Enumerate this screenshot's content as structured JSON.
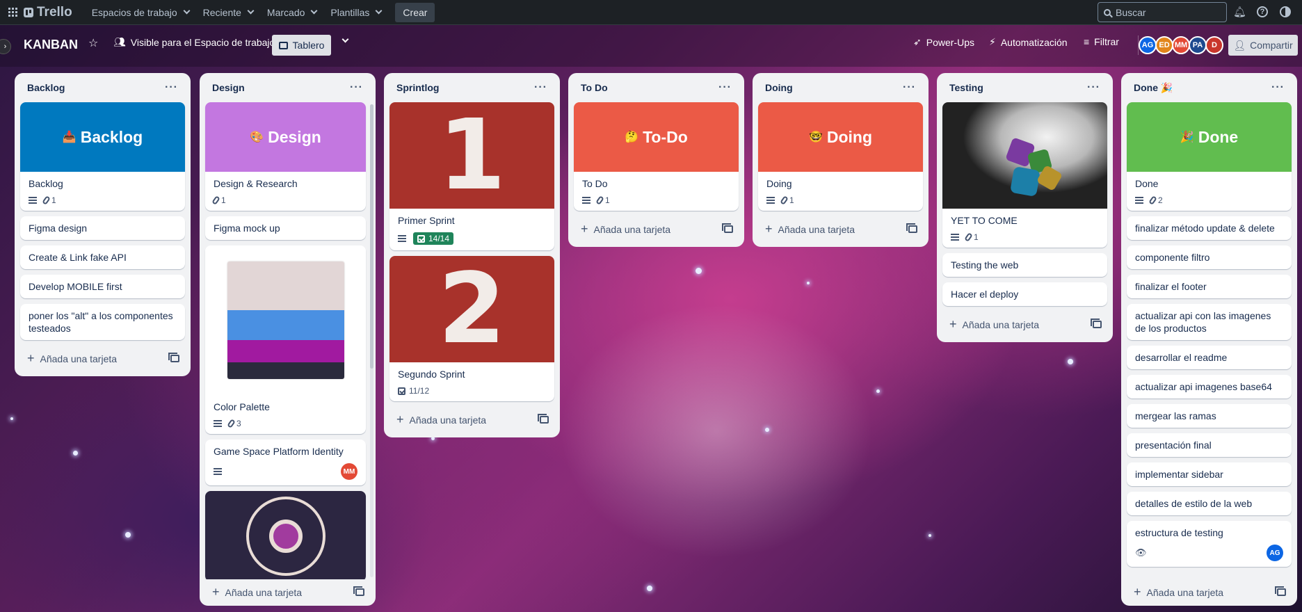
{
  "topnav": {
    "brand": "Trello",
    "menus": [
      "Espacios de trabajo",
      "Reciente",
      "Marcado",
      "Plantillas"
    ],
    "create": "Crear",
    "search_placeholder": "Buscar"
  },
  "board": {
    "title": "KANBAN",
    "visibility": "Visible para el Espacio de trabajo",
    "view": "Tablero",
    "powerups": "Power-Ups",
    "automation": "Automatización",
    "filter": "Filtrar",
    "share": "Compartir",
    "members": [
      {
        "initials": "AG",
        "color": "#0c66e4"
      },
      {
        "initials": "ED",
        "color": "#e2851a"
      },
      {
        "initials": "MM",
        "color": "#e34935"
      },
      {
        "initials": "PA",
        "color": "#1d4a8f"
      },
      {
        "initials": "D",
        "color": "#c9372c"
      }
    ]
  },
  "lists": {
    "backlog": {
      "title": "Backlog",
      "cover": {
        "label": "Backlog",
        "emoji": "📥",
        "color": "#0079bf"
      },
      "first_card": "Backlog",
      "first_attach": "1",
      "cards": [
        "Figma design",
        "Create & Link fake API",
        "Develop MOBILE first",
        "poner los \"alt\" a los componentes testeados"
      ],
      "add": "Añada una tarjeta"
    },
    "design": {
      "title": "Design",
      "cover": {
        "label": "Design",
        "emoji": "🎨",
        "color": "#c377e0"
      },
      "first_card": "Design & Research",
      "first_attach": "1",
      "card2": "Figma mock up",
      "palette_title": "Color Palette",
      "palette_attach": "3",
      "palette_colors": [
        "#e2d6d6",
        "#4a90e2",
        "#a11aa0",
        "#2a2a3c"
      ],
      "identity_title": "Game Space Platform Identity",
      "identity_member": "MM",
      "add": "Añada una tarjeta"
    },
    "sprintlog": {
      "title": "Sprintlog",
      "sprint1_num": "1",
      "sprint1_title": "Primer Sprint",
      "sprint1_check": "14/14",
      "sprint2_num": "2",
      "sprint2_title": "Segundo Sprint",
      "sprint2_check": "11/12",
      "add": "Añada una tarjeta"
    },
    "todo": {
      "title": "To Do",
      "cover": {
        "label": "To-Do",
        "emoji": "🤔",
        "color": "#eb5a46"
      },
      "first_card": "To Do",
      "first_attach": "1",
      "add": "Añada una tarjeta"
    },
    "doing": {
      "title": "Doing",
      "cover": {
        "label": "Doing",
        "emoji": "🤓",
        "color": "#eb5a46"
      },
      "first_card": "Doing",
      "first_attach": "1",
      "add": "Añada una tarjeta"
    },
    "testing": {
      "title": "Testing",
      "first_card": "YET TO COME",
      "first_attach": "1",
      "cards": [
        "Testing the web",
        "Hacer el deploy"
      ],
      "add": "Añada una tarjeta"
    },
    "done": {
      "title": "Done",
      "title_emoji": "🎉",
      "cover": {
        "label": "Done",
        "emoji": "🎉",
        "color": "#61bd4f"
      },
      "first_card": "Done",
      "first_attach": "2",
      "cards": [
        "finalizar método update & delete",
        "componente filtro",
        "finalizar el footer",
        "actualizar api con las imagenes de los productos",
        "desarrollar el readme",
        "actualizar api imagenes base64",
        "mergear las ramas",
        "presentación final",
        "implementar sidebar",
        "detalles de estilo de la web"
      ],
      "last_card": "estructura de testing",
      "last_member": "AG",
      "add": "Añada una tarjeta"
    }
  }
}
